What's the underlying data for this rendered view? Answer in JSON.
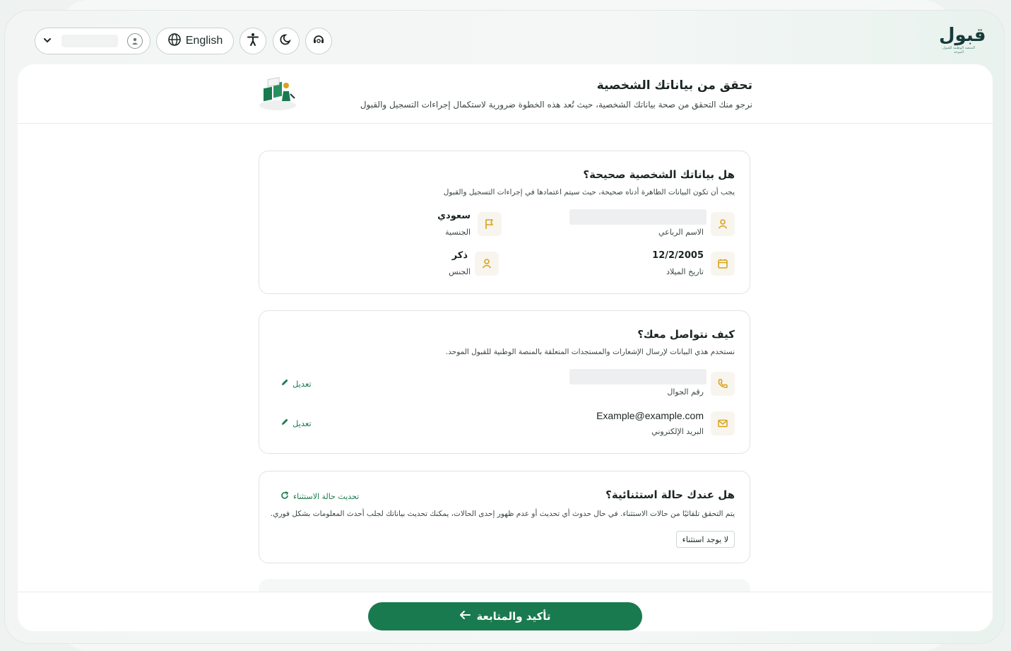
{
  "topbar": {
    "language_label": "English",
    "icons": [
      "chevron-down-icon",
      "user-icon",
      "globe-icon",
      "accessibility-icon",
      "moon-icon",
      "support-icon"
    ],
    "logo_text": "قبول",
    "logo_subtitle": "المنصة الوطنية للقبول الموحد"
  },
  "header": {
    "title": "تحقق من بياناتك الشخصية",
    "subtitle": "نرجو منك التحقق من صحة بياناتك الشخصية، حيث تُعد هذه الخطوة ضرورية لاستكمال إجراءات التسجيل والقبول"
  },
  "personal": {
    "title": "هل بياناتك الشخصية صحيحة؟",
    "desc": "يجب أن تكون البيانات الظاهرة أدناه صحيحة، حيث سيتم اعتمادها في إجراءات التسجيل والقبول",
    "full_name_label": "الاسم الرباعي",
    "nationality_value": "سعودي",
    "nationality_label": "الجنسية",
    "dob_value": "12/2/2005",
    "dob_label": "تاريخ الميلاد",
    "gender_value": "ذكر",
    "gender_label": "الجنس"
  },
  "contact": {
    "title": "كيف نتواصل معك؟",
    "desc": "نستخدم هذي البيانات لإرسال الإشعارات والمستجدات المتعلقة بالمنصة الوطنية للقبول الموحد.",
    "phone_label": "رقم الجوال",
    "email_value": "Example@example.com",
    "email_label": "البريد الإلكتروني",
    "edit_label": "تعديل"
  },
  "exception": {
    "title": "هل عندك حالة استثنائية؟",
    "desc": "يتم التحقق تلقائيًا من حالات الاستثناء. في حال حدوث أي تحديث أو عدم ظهور إحدى الحالات، يمكنك تحديث بياناتك لجلب أحدث المعلومات بشكل فوري.",
    "refresh_label": "تحديث حالة الاستثناء",
    "badge": "لا يوجد استثناء"
  },
  "footer": {
    "confirm_label": "تأكيد والمتابعة"
  },
  "colors": {
    "primary": "#1a7a4f",
    "accent_icon": "#d9a21b",
    "text": "#1c2525"
  }
}
